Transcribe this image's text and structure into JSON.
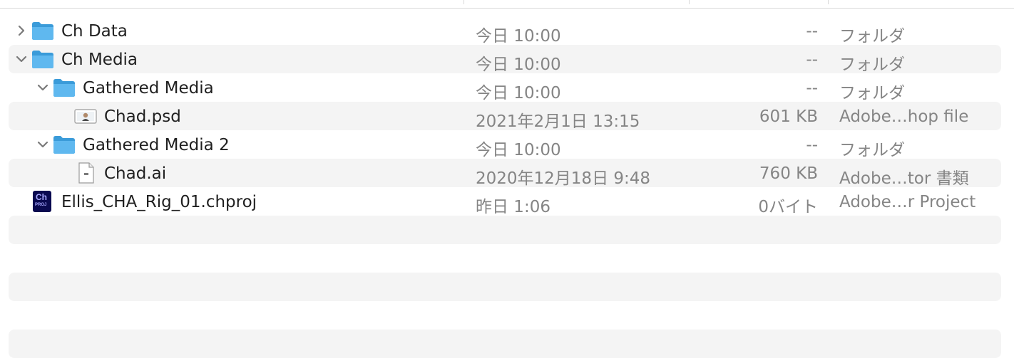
{
  "file_list": {
    "rows": [
      {
        "name": "Ch Data",
        "date": "今日 10:00",
        "size": "--",
        "kind": "フォルダ",
        "icon": "folder-icon",
        "expanded": false
      },
      {
        "name": "Ch Media",
        "date": "今日 10:00",
        "size": "--",
        "kind": "フォルダ",
        "icon": "folder-icon",
        "expanded": true
      },
      {
        "name": "Gathered Media",
        "date": "今日 10:00",
        "size": "--",
        "kind": "フォルダ",
        "icon": "folder-icon",
        "expanded": true
      },
      {
        "name": "Chad.psd",
        "date": "2021年2月1日 13:15",
        "size": "601 KB",
        "kind": "Adobe…hop file",
        "icon": "psd-file-icon"
      },
      {
        "name": "Gathered Media 2",
        "date": "今日 10:00",
        "size": "--",
        "kind": "フォルダ",
        "icon": "folder-icon",
        "expanded": true
      },
      {
        "name": "Chad.ai",
        "date": "2020年12月18日 9:48",
        "size": "760 KB",
        "kind": "Adobe…tor 書類",
        "icon": "ai-file-icon"
      },
      {
        "name": "Ellis_CHA_Rig_01.chproj",
        "date": "昨日 1:06",
        "size": "0バイト",
        "kind": "Adobe…r Project",
        "icon": "chproj-file-icon",
        "icon_text": "Ch",
        "icon_subtext": "PROJ"
      }
    ]
  }
}
